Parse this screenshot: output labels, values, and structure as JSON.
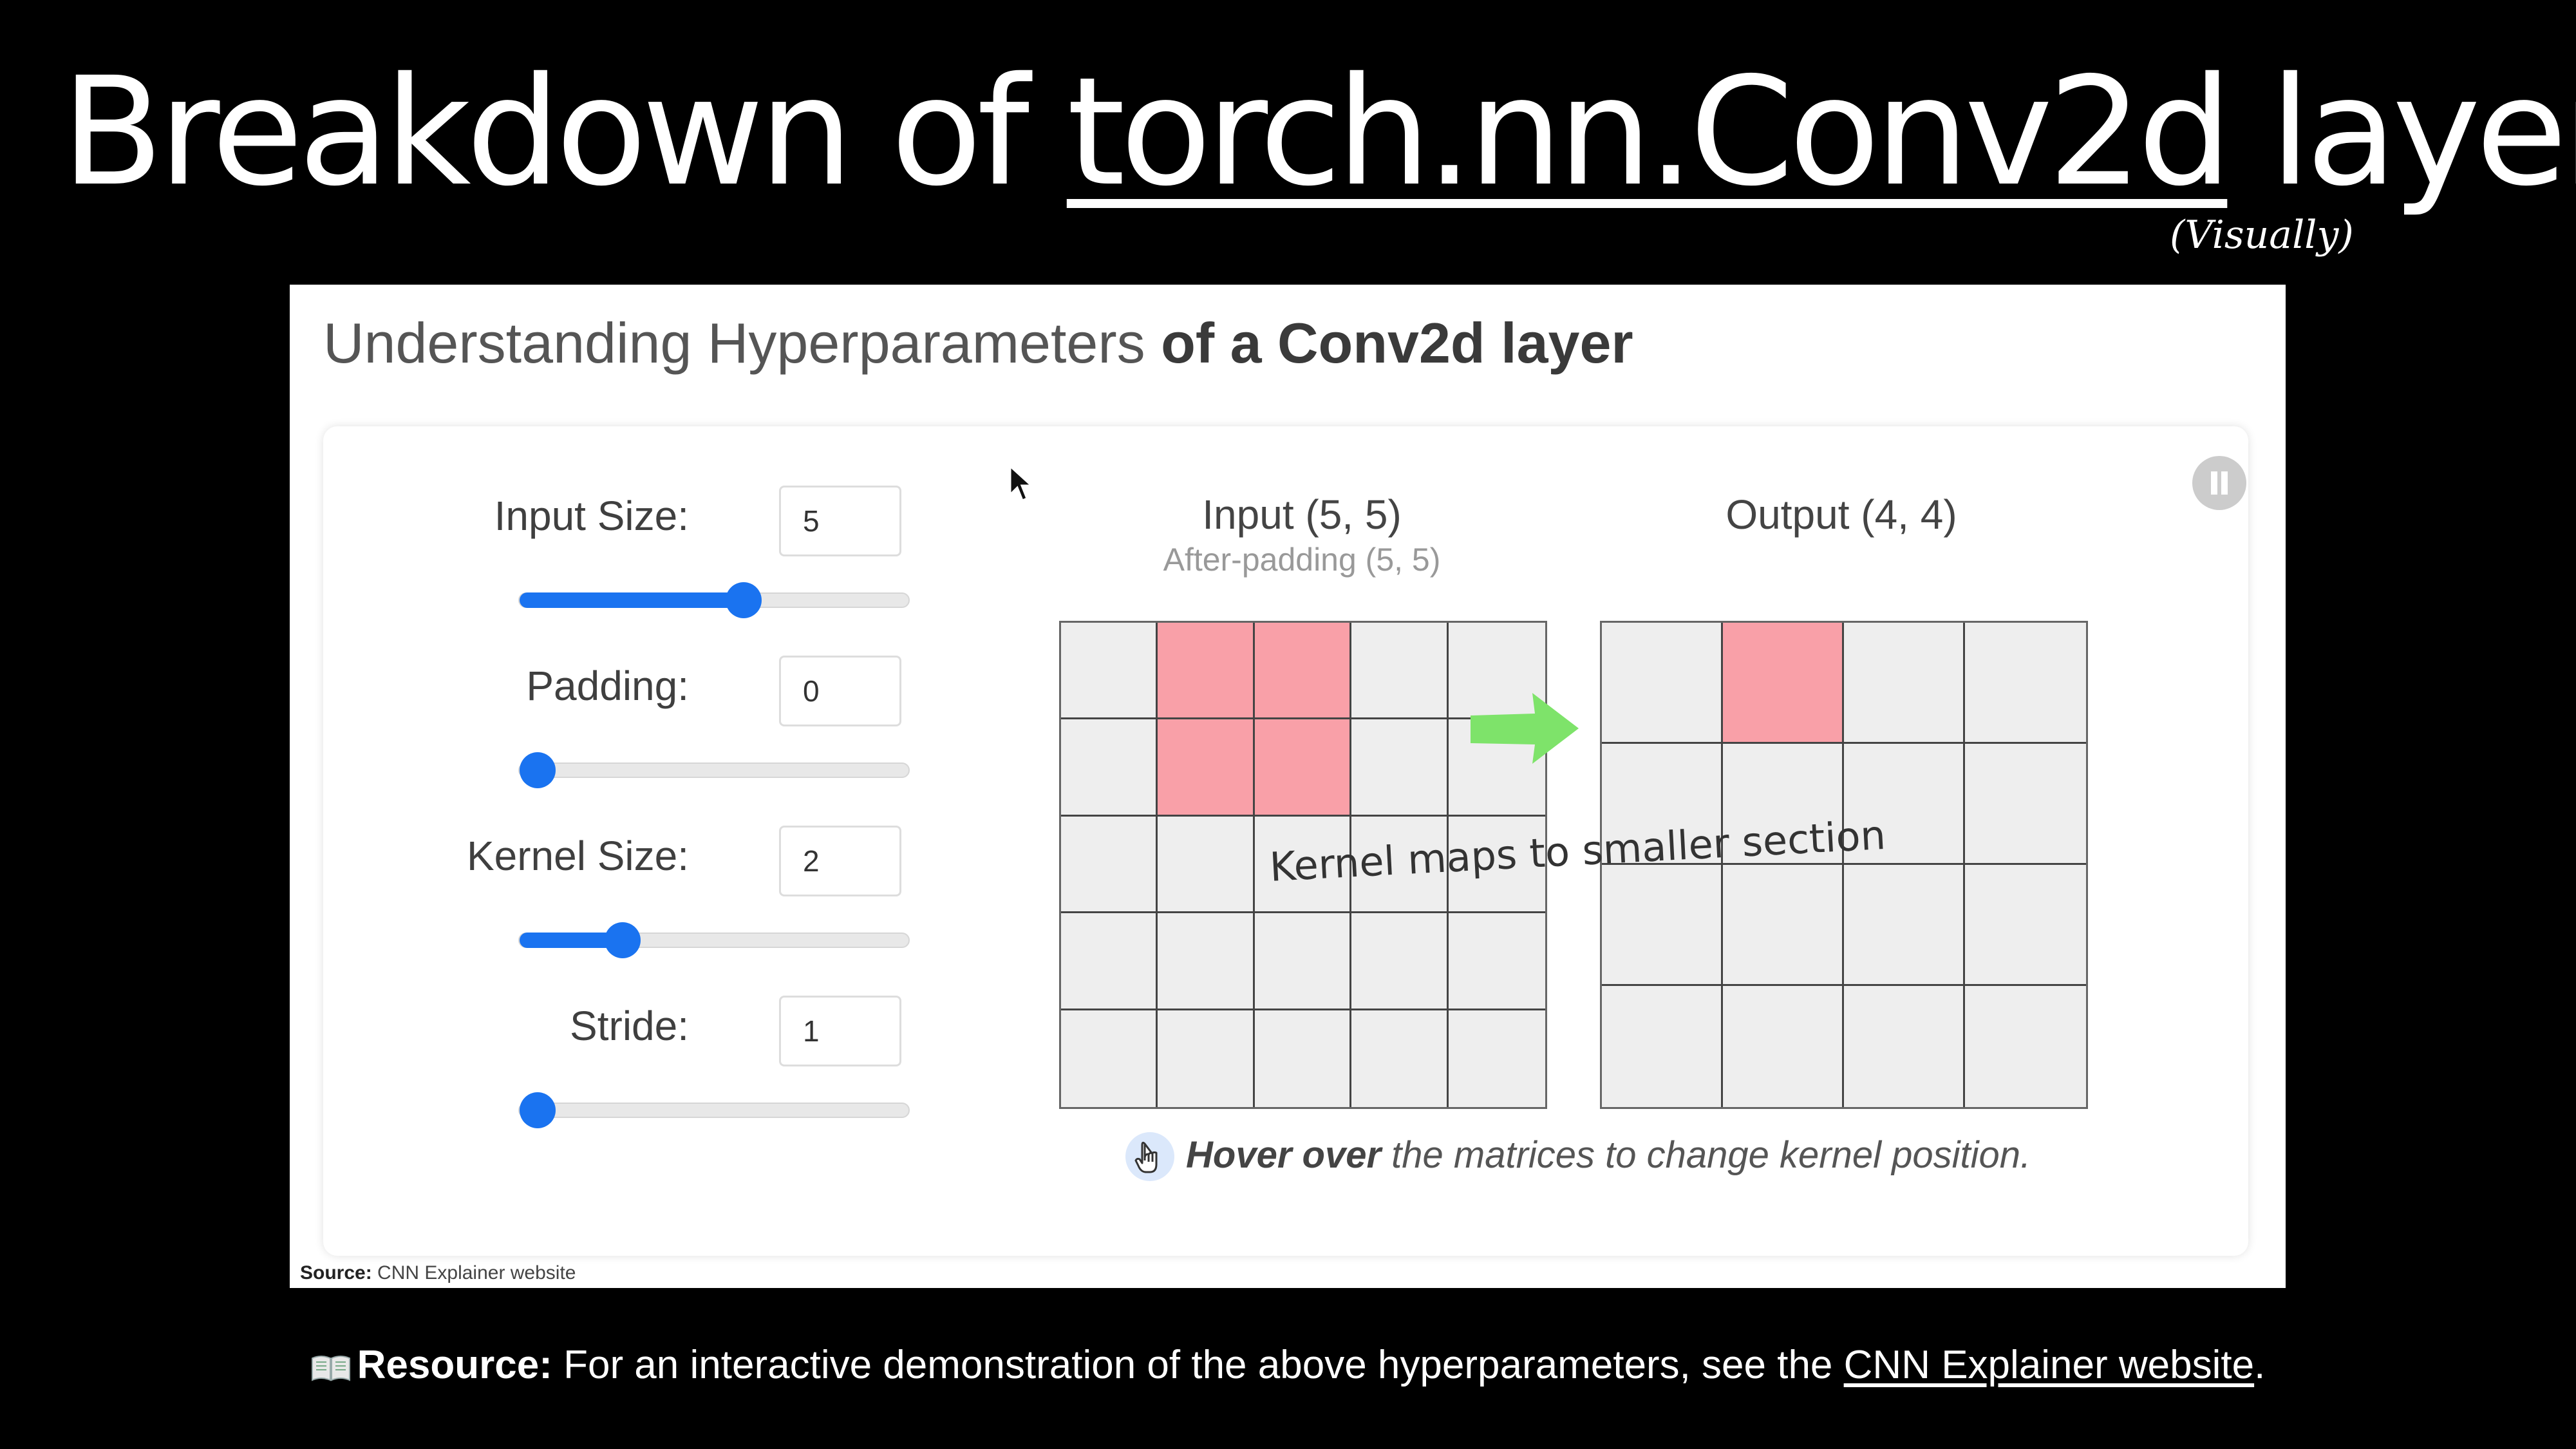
{
  "slide": {
    "title_prefix": "Breakdown of ",
    "title_code": "torch.nn.Conv2d",
    "title_suffix": " layer",
    "subtitle": "(Visually)"
  },
  "screenshot": {
    "heading_light": "Understanding Hyperparameters ",
    "heading_bold": "of a Conv2d layer",
    "controls": [
      {
        "label": "Input Size:",
        "value": "5",
        "slider_fraction": 0.58
      },
      {
        "label": "Padding:",
        "value": "0",
        "slider_fraction": 0.0
      },
      {
        "label": "Kernel Size:",
        "value": "2",
        "slider_fraction": 0.24
      },
      {
        "label": "Stride:",
        "value": "1",
        "slider_fraction": 0.0
      }
    ],
    "input_matrix": {
      "title": "Input (5, 5)",
      "subtitle": "After-padding (5, 5)",
      "rows": 5,
      "cols": 5,
      "highlighted": [
        [
          0,
          1
        ],
        [
          0,
          2
        ],
        [
          1,
          1
        ],
        [
          1,
          2
        ]
      ]
    },
    "output_matrix": {
      "title": "Output (4, 4)",
      "rows": 4,
      "cols": 4,
      "highlighted": [
        [
          0,
          1
        ]
      ]
    },
    "annotation": "Kernel maps to smaller section",
    "hint_bold": "Hover over",
    "hint_rest": " the matrices to change kernel position.",
    "source_bold": "Source:",
    "source_rest": " CNN Explainer website",
    "colors": {
      "accent": "#1a73f0",
      "highlight": "#f9a0a8",
      "arrow": "#7ee36a"
    }
  },
  "resource": {
    "icon": "book-icon",
    "label": "Resource:",
    "text": " For an interactive demonstration of the above hyperparameters, see the ",
    "link": "CNN Explainer website",
    "end": "."
  }
}
